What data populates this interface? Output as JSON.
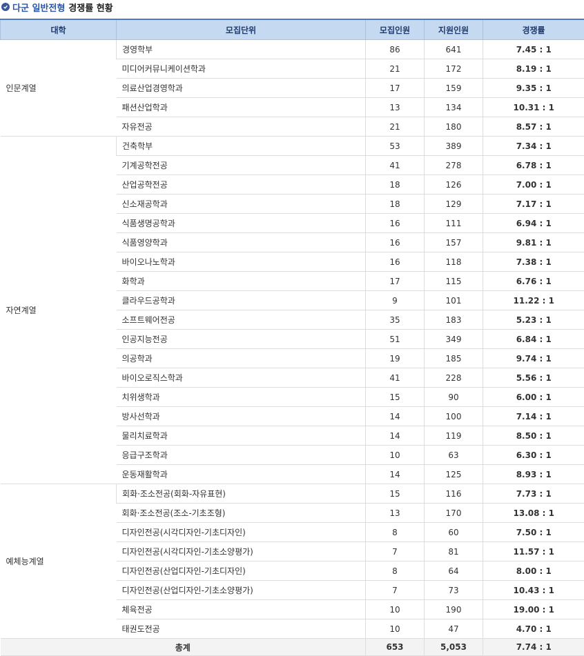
{
  "title": {
    "accent": "다군 일반전형",
    "rest": "경쟁률 현황"
  },
  "columns": [
    "대학",
    "모집단위",
    "모집인원",
    "지원인원",
    "경쟁률"
  ],
  "groups": [
    {
      "name": "인문계열",
      "rows": [
        [
          "경영학부",
          "86",
          "641",
          "7.45 : 1"
        ],
        [
          "미디어커뮤니케이션학과",
          "21",
          "172",
          "8.19 : 1"
        ],
        [
          "의료산업경영학과",
          "17",
          "159",
          "9.35 : 1"
        ],
        [
          "패션산업학과",
          "13",
          "134",
          "10.31 : 1"
        ],
        [
          "자유전공",
          "21",
          "180",
          "8.57 : 1"
        ]
      ]
    },
    {
      "name": "자연계열",
      "rows": [
        [
          "건축학부",
          "53",
          "389",
          "7.34 : 1"
        ],
        [
          "기계공학전공",
          "41",
          "278",
          "6.78 : 1"
        ],
        [
          "산업공학전공",
          "18",
          "126",
          "7.00 : 1"
        ],
        [
          "신소재공학과",
          "18",
          "129",
          "7.17 : 1"
        ],
        [
          "식품생명공학과",
          "16",
          "111",
          "6.94 : 1"
        ],
        [
          "식품영양학과",
          "16",
          "157",
          "9.81 : 1"
        ],
        [
          "바이오나노학과",
          "16",
          "118",
          "7.38 : 1"
        ],
        [
          "화학과",
          "17",
          "115",
          "6.76 : 1"
        ],
        [
          "클라우드공학과",
          "9",
          "101",
          "11.22 : 1"
        ],
        [
          "소프트웨어전공",
          "35",
          "183",
          "5.23 : 1"
        ],
        [
          "인공지능전공",
          "51",
          "349",
          "6.84 : 1"
        ],
        [
          "의공학과",
          "19",
          "185",
          "9.74 : 1"
        ],
        [
          "바이오로직스학과",
          "41",
          "228",
          "5.56 : 1"
        ],
        [
          "치위생학과",
          "15",
          "90",
          "6.00 : 1"
        ],
        [
          "방사선학과",
          "14",
          "100",
          "7.14 : 1"
        ],
        [
          "물리치료학과",
          "14",
          "119",
          "8.50 : 1"
        ],
        [
          "응급구조학과",
          "10",
          "63",
          "6.30 : 1"
        ],
        [
          "운동재활학과",
          "14",
          "125",
          "8.93 : 1"
        ]
      ]
    },
    {
      "name": "예체능계열",
      "rows": [
        [
          "회화·조소전공(회화-자유표현)",
          "15",
          "116",
          "7.73 : 1"
        ],
        [
          "회화·조소전공(조소-기초조형)",
          "13",
          "170",
          "13.08 : 1"
        ],
        [
          "디자인전공(시각디자인-기초디자인)",
          "8",
          "60",
          "7.50 : 1"
        ],
        [
          "디자인전공(시각디자인-기초소양평가)",
          "7",
          "81",
          "11.57 : 1"
        ],
        [
          "디자인전공(산업디자인-기초디자인)",
          "8",
          "64",
          "8.00 : 1"
        ],
        [
          "디자인전공(산업디자인-기초소양평가)",
          "7",
          "73",
          "10.43 : 1"
        ],
        [
          "체육전공",
          "10",
          "190",
          "19.00 : 1"
        ],
        [
          "태권도전공",
          "10",
          "47",
          "4.70 : 1"
        ]
      ]
    }
  ],
  "total": {
    "label": "총계",
    "quota": "653",
    "applicants": "5,053",
    "ratio": "7.74 : 1"
  }
}
